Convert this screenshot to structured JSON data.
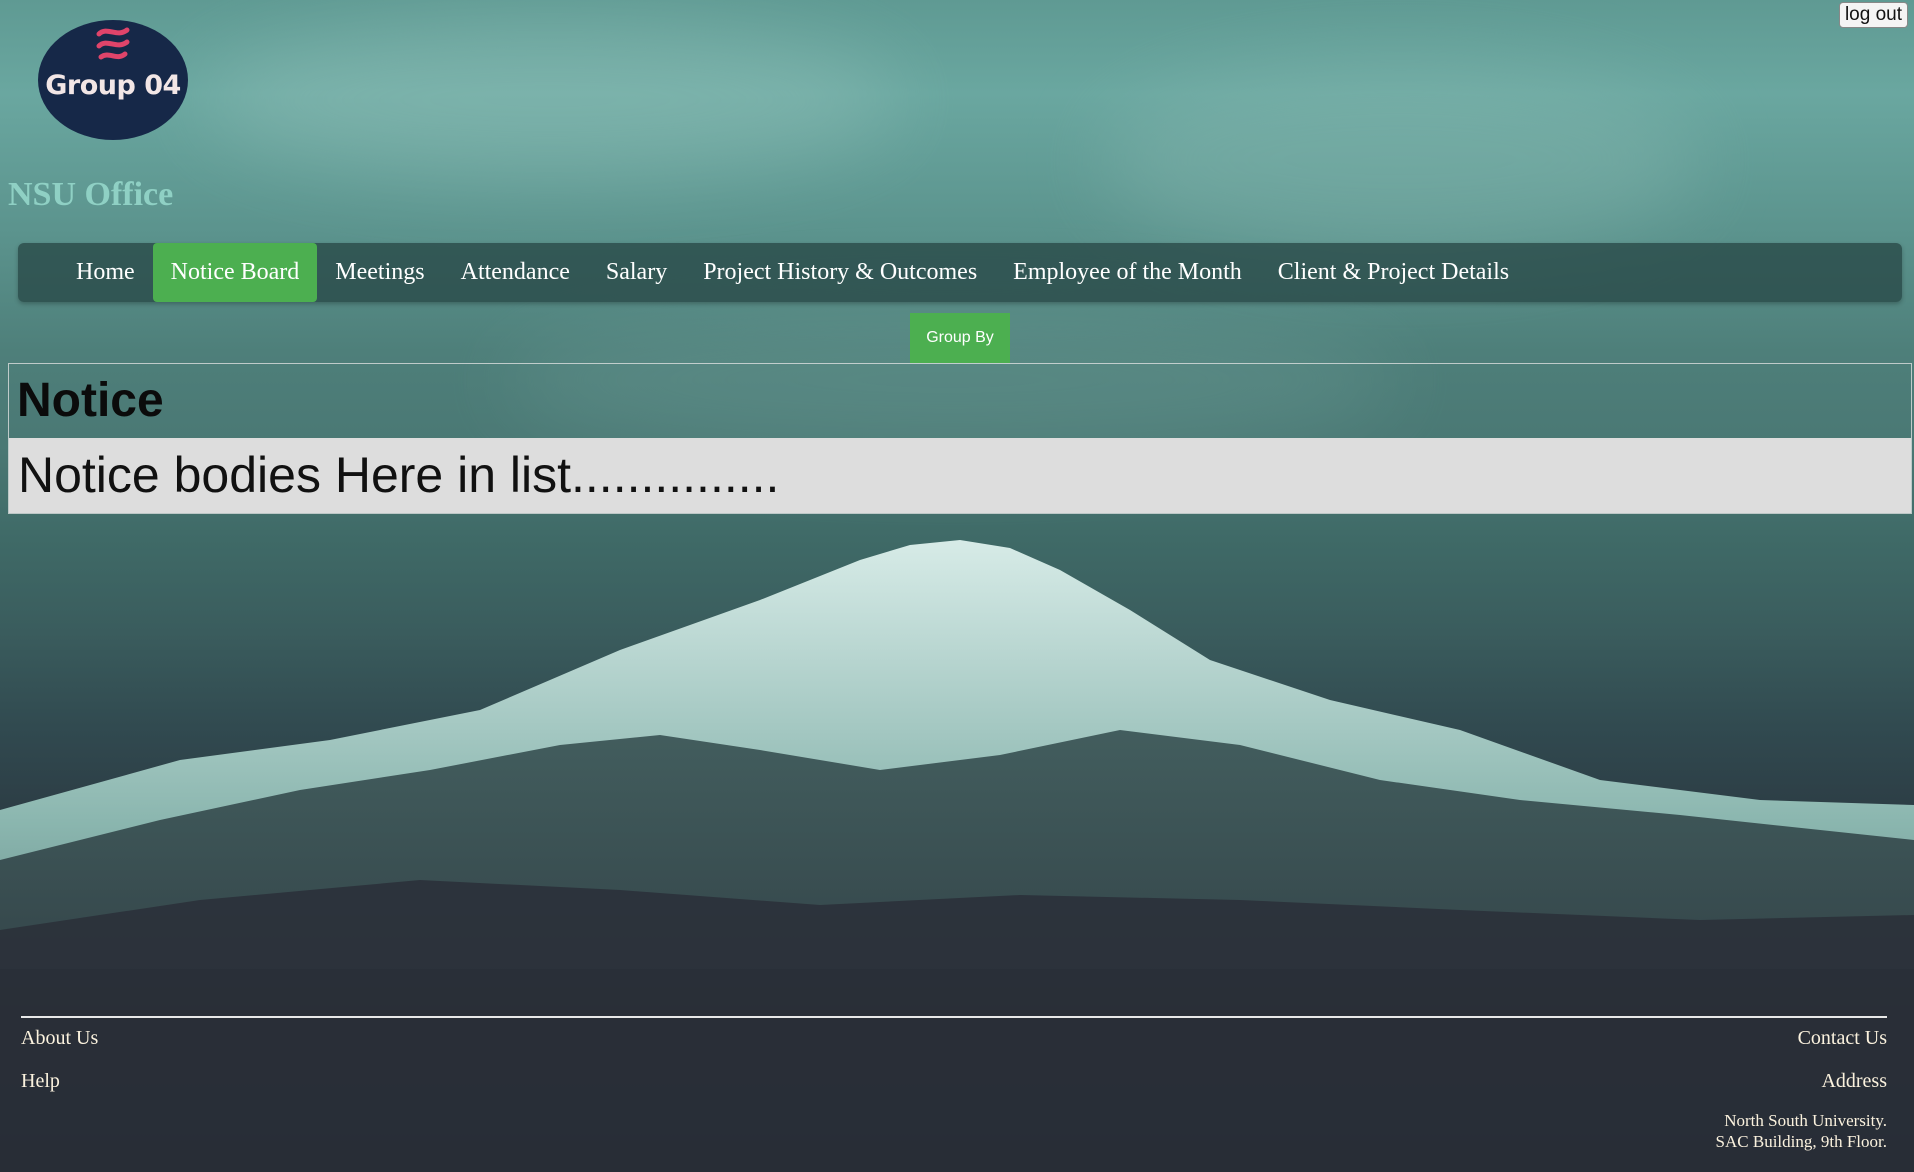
{
  "header": {
    "logout_label": "log out",
    "logo_text": "Group 04",
    "site_title": "NSU Office"
  },
  "nav": {
    "items": [
      {
        "label": "Home",
        "active": false
      },
      {
        "label": "Notice Board",
        "active": true
      },
      {
        "label": "Meetings",
        "active": false
      },
      {
        "label": "Attendance",
        "active": false
      },
      {
        "label": "Salary",
        "active": false
      },
      {
        "label": "Project History & Outcomes",
        "active": false
      },
      {
        "label": "Employee of the Month",
        "active": false
      },
      {
        "label": "Client & Project Details",
        "active": false
      }
    ]
  },
  "toolbar": {
    "group_by_label": "Group By"
  },
  "notice": {
    "heading": "Notice",
    "body": "Notice bodies Here in list..............."
  },
  "footer": {
    "about_label": "About Us",
    "help_label": "Help",
    "contact_label": "Contact Us",
    "address_label": "Address",
    "address_line1": "North South University.",
    "address_line2": "SAC Building, 9th Floor."
  },
  "colors": {
    "accent_green": "#4caf50",
    "logo_navy": "#162848",
    "title_teal": "#8fd0c4"
  }
}
